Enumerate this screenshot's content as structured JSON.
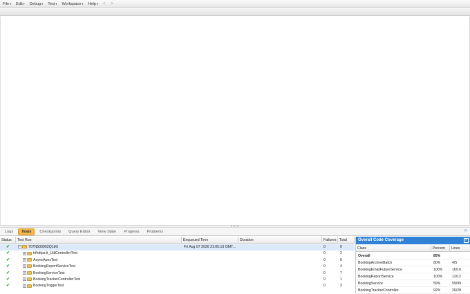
{
  "menu": {
    "items": [
      {
        "label": "File"
      },
      {
        "label": "Edit"
      },
      {
        "label": "Debug"
      },
      {
        "label": "Test"
      },
      {
        "label": "Workspace"
      },
      {
        "label": "Help"
      }
    ],
    "caret": "▾",
    "back_glyph": "<",
    "forward_glyph": ">"
  },
  "tabs": [
    {
      "label": "Logs",
      "active": false
    },
    {
      "label": "Tests",
      "active": true
    },
    {
      "label": "Checkpoints",
      "active": false
    },
    {
      "label": "Query Editor",
      "active": false
    },
    {
      "label": "View State",
      "active": false
    },
    {
      "label": "Progress",
      "active": false
    },
    {
      "label": "Problems",
      "active": false
    }
  ],
  "tests": {
    "columns": {
      "status": "Status",
      "test_run": "Test Run",
      "enqueued": "Enqueued Time",
      "duration": "Duration",
      "failures": "Failures",
      "total": "Total"
    },
    "rows": [
      {
        "name": "707N500002Q1tKt",
        "enqueued": "Fri Aug 07 2026 21:05:13 GMT...",
        "duration": "",
        "failures": "0",
        "total": "0",
        "expander": "−",
        "root": true
      },
      {
        "name": "trfhdtps.tt_UtilControllerTest",
        "enqueued": "",
        "duration": "",
        "failures": "0",
        "total": "2",
        "expander": "+",
        "root": false
      },
      {
        "name": "AsyncApexTest",
        "enqueued": "",
        "duration": "",
        "failures": "0",
        "total": "6",
        "expander": "+",
        "root": false
      },
      {
        "name": "BookingReportServiceTest",
        "enqueued": "",
        "duration": "",
        "failures": "0",
        "total": "4",
        "expander": "+",
        "root": false
      },
      {
        "name": "BookingServiceTest",
        "enqueued": "",
        "duration": "",
        "failures": "0",
        "total": "7",
        "expander": "+",
        "root": false
      },
      {
        "name": "BookingTrackerControllerTest",
        "enqueued": "",
        "duration": "",
        "failures": "0",
        "total": "1",
        "expander": "+",
        "root": false
      },
      {
        "name": "BookingTriggerTest",
        "enqueued": "",
        "duration": "",
        "failures": "0",
        "total": "3",
        "expander": "+",
        "root": false
      }
    ],
    "check_glyph": "✔"
  },
  "coverage": {
    "title": "Overall Code Coverage",
    "close_glyph": "×",
    "columns": {
      "class": "Class",
      "percent": "Percent",
      "lines": "Lines"
    },
    "rows": [
      {
        "class": "Overall",
        "percent": "85%",
        "lines": ""
      },
      {
        "class": "BookingArchiveBatch",
        "percent": "80%",
        "lines": "4/5"
      },
      {
        "class": "BookingEmailFutureService",
        "percent": "100%",
        "lines": "16/16"
      },
      {
        "class": "BookingReportService",
        "percent": "100%",
        "lines": "12/12"
      },
      {
        "class": "BookingService",
        "percent": "59%",
        "lines": "59/99"
      },
      {
        "class": "BookingTrackerController",
        "percent": "92%",
        "lines": "26/28"
      }
    ]
  },
  "colors": {
    "active_tab": "#f6b84a",
    "coverage_header": "#2f82d6",
    "pass": "#2a9d2a",
    "selected_row": "#dbe9f9"
  }
}
